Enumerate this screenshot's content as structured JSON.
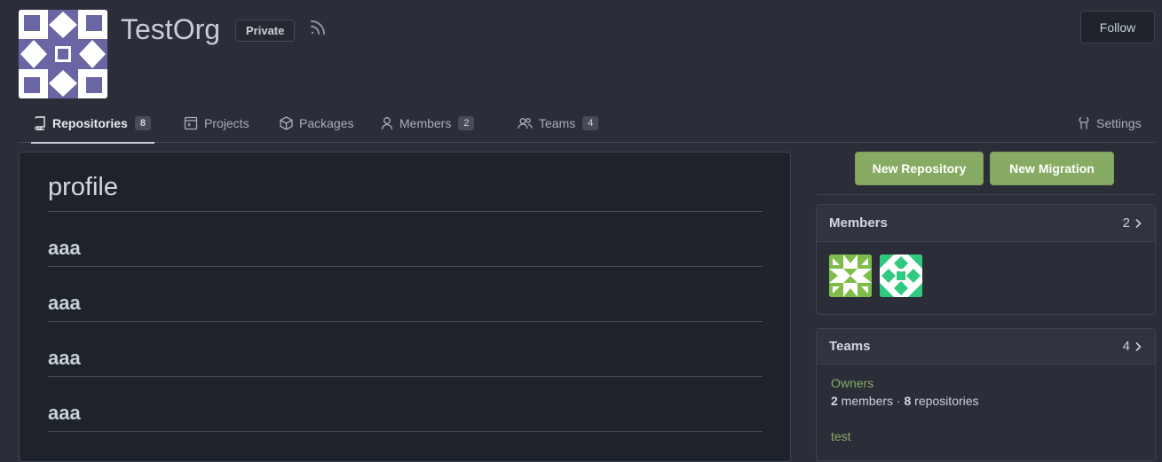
{
  "org": {
    "name": "TestOrg",
    "visibility_badge": "Private",
    "follow_label": "Follow"
  },
  "tabs": [
    {
      "label": "Repositories",
      "count": "8",
      "icon": "repo-icon",
      "active": true
    },
    {
      "label": "Projects",
      "count": "",
      "icon": "project-icon"
    },
    {
      "label": "Packages",
      "count": "",
      "icon": "package-icon"
    },
    {
      "label": "Members",
      "count": "2",
      "icon": "person-icon"
    },
    {
      "label": "Teams",
      "count": "4",
      "icon": "people-icon"
    },
    {
      "label": "Settings",
      "count": "",
      "icon": "tools-icon"
    }
  ],
  "readme": {
    "title": "profile",
    "headings": [
      "aaa",
      "aaa",
      "aaa",
      "aaa"
    ]
  },
  "actions": {
    "new_repository": "New Repository",
    "new_migration": "New Migration"
  },
  "members_card": {
    "title": "Members",
    "count": "2"
  },
  "teams_card": {
    "title": "Teams",
    "count": "4",
    "teams": [
      {
        "name": "Owners",
        "members": "2",
        "members_label": " members · ",
        "repos": "8",
        "repos_label": " repositories"
      },
      {
        "name": "test",
        "members": "",
        "members_label": "",
        "repos": "",
        "repos_label": ""
      }
    ]
  },
  "colors": {
    "accent_green": "#87ab63",
    "page_bg": "#2b2e38",
    "panel_bg": "#1e222a"
  }
}
